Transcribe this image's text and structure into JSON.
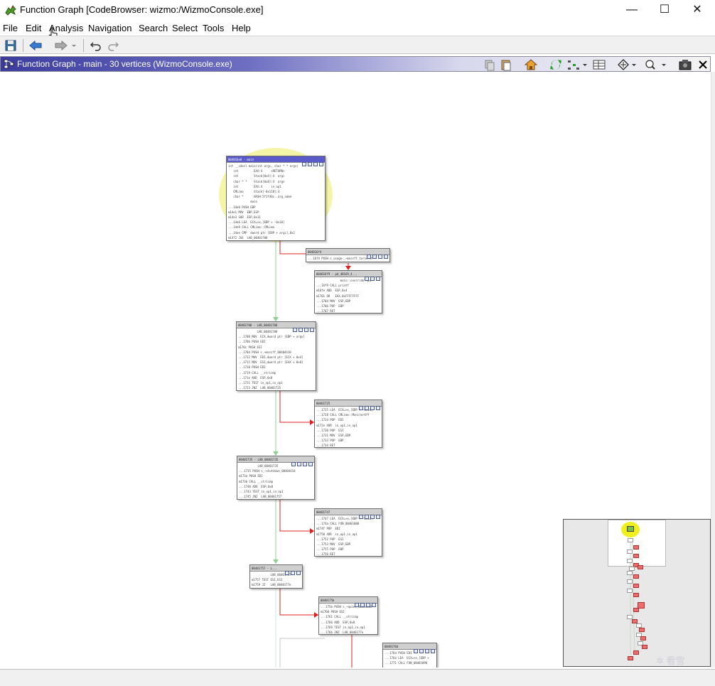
{
  "window": {
    "title": "Function Graph [CodeBrowser: wizmo:/WizmoConsole.exe]",
    "minimize": "—",
    "maximize": "☐",
    "close": "✕"
  },
  "menu": [
    "File",
    "Edit",
    "Analysis",
    "Navigation",
    "Search",
    "Select",
    "Tools",
    "Help"
  ],
  "panel": {
    "title": "Function Graph - main - 30 vertices  (WizmoConsole.exe)"
  },
  "colors": {
    "header_start": "#3b3c9e",
    "entry_highlight": "#f5f5a8",
    "edge_true": "#e02020",
    "edge_fall": "#8fd08f"
  },
  "vertices": [
    {
      "id": "v-main",
      "label": "004016e0 - main",
      "entry": true,
      "lines": [
        "int __cdecl main(int argc, char * * argv)",
        "   int         EAX:4     <RETURN>",
        "   int         Stack[0x4]:4  argc",
        "   char * *    Stack[0x8]:4  argv",
        "   int         EAX:4     in_op1",
        "   CMLimo      Stack[-0x118]:4",
        "   char *      HASH:5f1f40c..arg_name",
        "             main",
        "...14e0 PUSH EBP",
        "m14e1 MOV  EBP,ESP",
        "m14e3 SUB  ESP,0x11",
        "...14e6 LEA  ECX=>x,[EBP + -0x10]",
        "...14e9 CALL CMLimo::CMLimo",
        "...14ee CMP  dword ptr [EBP + argc],0x2",
        "m1472 JGE  LAB_00401708"
      ]
    },
    {
      "id": "v-usage",
      "label": "004016f4",
      "entry": false,
      "lines": [
        "...16f4 PUSH s_usage:_~mossff_turns_th"
      ]
    },
    {
      "id": "v-printf",
      "label": "004016f9 - pd_40169_4...",
      "entry": false,
      "lines": [
        "              main::override::pu",
        "...16f9 CALL printf",
        "m16fe ADD  ESP,0x4",
        "m1701 OR   EAX,0xFFFFFFFF",
        "...1704 MOV  ESP,EBP",
        "...1706 POP  EBP",
        "...1707 RET"
      ]
    },
    {
      "id": "v-1708",
      "label": "00401708 - LAB_00401708",
      "entry": false,
      "lines": [
        "           LAB_00401708",
        "...1708 MOV  ECX,dword ptr [EBP + argv]",
        "...170b PUSH EDI",
        "m170c PUSH ESI",
        "...170d PUSH s_~mossff_00404410",
        "...1712 MOV  EDI,dword ptr [ECX + 0x4]",
        "...1715 MOV  ESI,dword ptr [EAX + 0x8]",
        "...1718 PUSH EDI",
        "...1719 CALL __stricmp",
        "...171e ADD  ESP,0x8",
        "...1721 TEST in_op1,in_op1",
        "...1723 JNZ  LAB_00401735"
      ]
    },
    {
      "id": "v-1725",
      "label": "00401725",
      "entry": false,
      "lines": [
        "...1725 LEA  ECX=>x,[EBP + -0x10]",
        "...1728 CALL CMLimo::MonitorOff",
        "...172d POP  EDI",
        "m172e XOR  in_op1,in_op1",
        "...1730 POP  ESI",
        "...1731 MOV  ESP,EBP",
        "...1733 POP  EBP",
        "...1734 RET"
      ]
    },
    {
      "id": "v-1735",
      "label": "00401735 - LAB_00401735",
      "entry": false,
      "lines": [
        "           LAB_00401735",
        "...1735 PUSH s_~shutdown_00404418",
        "m173a PUSH EDI",
        "m173b CALL __stricmp",
        "...1740 ADD  ESP,0x8",
        "...1743 TEST in_op1,in_op1",
        "...1745 JNZ  LAB_00401757"
      ]
    },
    {
      "id": "v-1747",
      "label": "00401747",
      "entry": false,
      "lines": [
        "...1747 LEA  ECX=>x,[EBP + -0x10]",
        "...174a CALL FUN_00401080",
        "m174f POP  EDI",
        "m1750 XOR  in_op1,in_op1",
        "...1752 POP  ESI",
        "...1753 MOV  ESP,EBP",
        "...1755 POP  EBP",
        "...1756 RET"
      ]
    },
    {
      "id": "v-1757",
      "label": "00401757 - L...",
      "entry": false,
      "lines": [
        "           LAB_00401757",
        "m1757 TEST ESI,ESI",
        "m1759 JZ   LAB_0040177e"
      ]
    },
    {
      "id": "v-175b",
      "label": "0040175b",
      "entry": false,
      "lines": [
        "...175b PUSH s_~quiet_00404428",
        "m1760 PUSH ESI",
        "...1761 CALL __stricmp",
        "...1766 ADD  ESP,0x8",
        "...1769 TEST in_op1,in_op1",
        "...176b JNZ  LAB_0040177e"
      ]
    },
    {
      "id": "v-176d",
      "label": "0040176d",
      "entry": false,
      "lines": [
        "...176d PUSH EDI",
        "...176e LEA  ECX=>x,[EBP +",
        "...1771 CALL FUN_00401090"
      ]
    }
  ]
}
